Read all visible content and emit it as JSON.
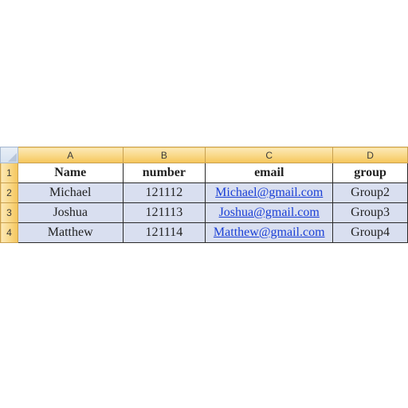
{
  "columns": [
    "A",
    "B",
    "C",
    "D"
  ],
  "rowNumbers": [
    "1",
    "2",
    "3",
    "4"
  ],
  "header": {
    "name": "Name",
    "number": "number",
    "email": "email",
    "group": "group"
  },
  "rows": [
    {
      "name": "Michael",
      "number": "121112",
      "email": "Michael@gmail.com",
      "group": "Group2"
    },
    {
      "name": "Joshua",
      "number": "121113",
      "email": "Joshua@gmail.com",
      "group": "Group3"
    },
    {
      "name": "Matthew",
      "number": "121114",
      "email": "Matthew@gmail.com",
      "group": "Group4"
    }
  ],
  "chart_data": {
    "type": "table",
    "columns": [
      "Name",
      "number",
      "email",
      "group"
    ],
    "data": [
      [
        "Michael",
        121112,
        "Michael@gmail.com",
        "Group2"
      ],
      [
        "Joshua",
        121113,
        "Joshua@gmail.com",
        "Group3"
      ],
      [
        "Matthew",
        121114,
        "Matthew@gmail.com",
        "Group4"
      ]
    ]
  }
}
